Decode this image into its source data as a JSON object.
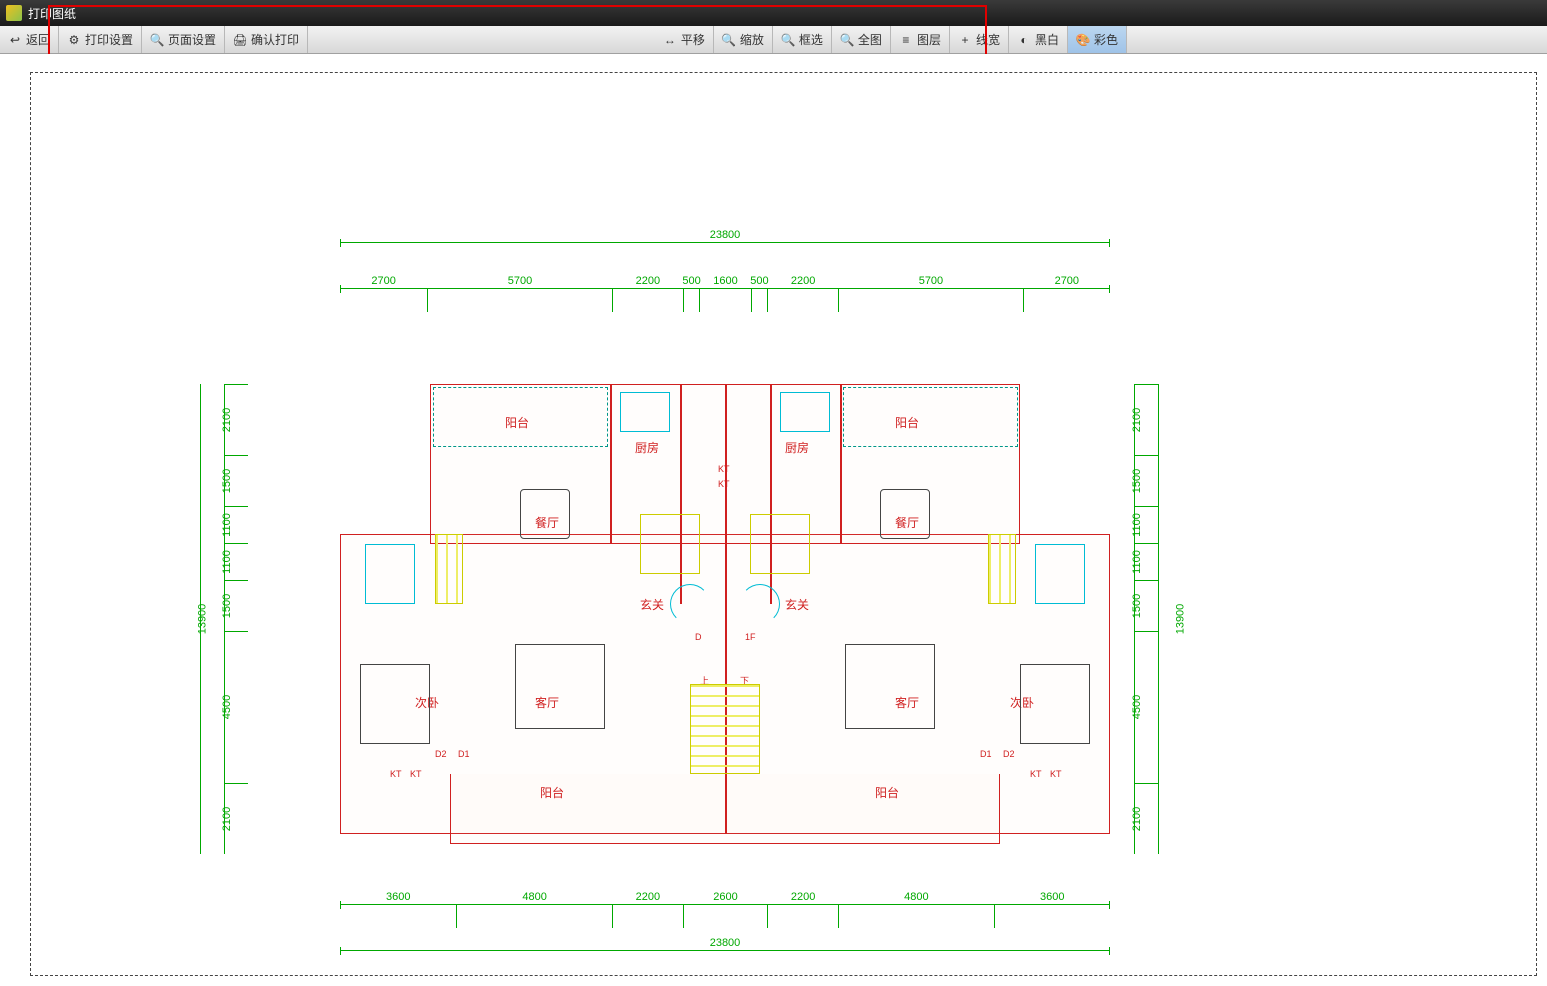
{
  "app": {
    "title": "打印图纸"
  },
  "toolbar": {
    "back": "返回",
    "print_settings": "打印设置",
    "page_settings": "页面设置",
    "confirm_print": "确认打印",
    "pan": "平移",
    "zoom": "缩放",
    "box_select": "框选",
    "fit_all": "全图",
    "layers": "图层",
    "line_width": "线宽",
    "bw": "黑白",
    "color": "彩色"
  },
  "dimensions": {
    "total_width": "23800",
    "top_segments": [
      "2700",
      "5700",
      "2200",
      "500",
      "1600",
      "500",
      "2200",
      "5700",
      "2700"
    ],
    "bottom_segments": [
      "3600",
      "4800",
      "2200",
      "2600",
      "2200",
      "4800",
      "3600"
    ],
    "total_height": "13900",
    "left_segments": [
      "2100",
      "1500",
      "1100",
      "1100",
      "1500",
      "4500",
      "2100"
    ],
    "right_segments": [
      "2100",
      "1500",
      "1100",
      "1100",
      "1500",
      "4500",
      "2100"
    ]
  },
  "rooms": {
    "balcony": "阳台",
    "kitchen": "厨房",
    "dining": "餐厅",
    "entrance": "玄关",
    "living": "客厅",
    "secondary_bedroom": "次卧",
    "up": "上",
    "down": "下"
  },
  "labels": {
    "d1": "D1",
    "d2": "D2",
    "d": "D",
    "f1": "1F",
    "kt": "KT"
  }
}
